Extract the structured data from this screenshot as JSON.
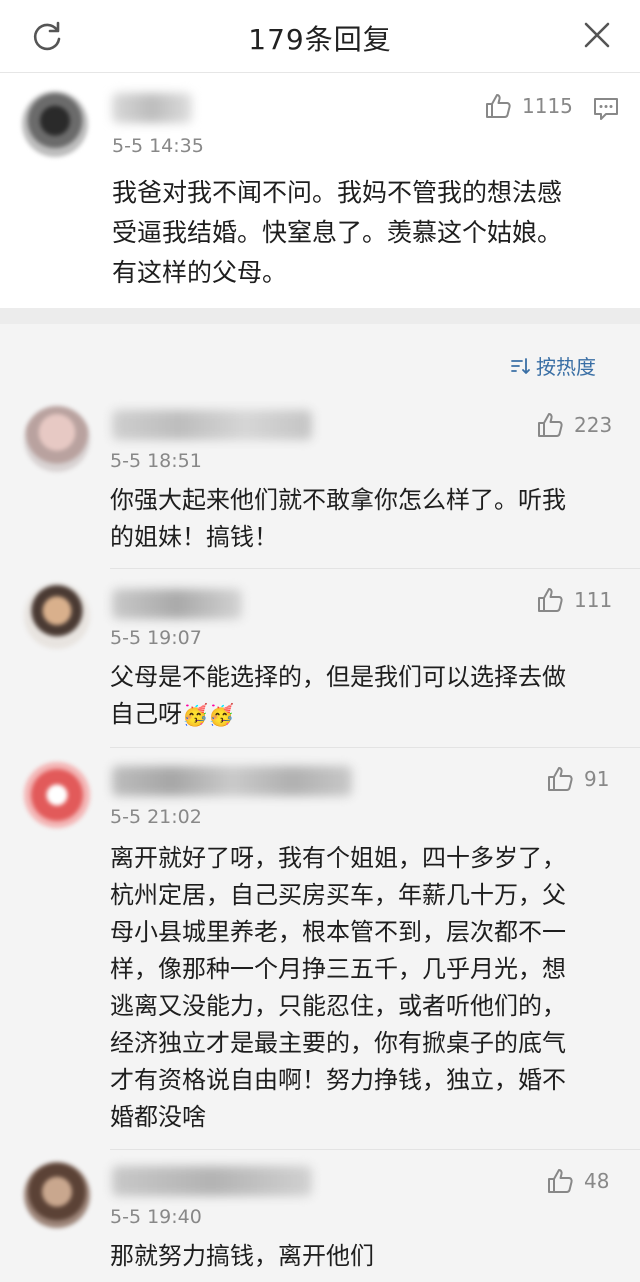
{
  "header": {
    "title": "179条回复",
    "icons": [
      "refresh-icon",
      "close-icon"
    ]
  },
  "main_post": {
    "time": "5-5 14:35",
    "likes": "1115",
    "text_lines": [
      "我爸对我不闻不问。我妈不管我的想法感",
      "受逼我结婚。快窒息了。羡慕这个姑娘。",
      "有这样的父母。"
    ]
  },
  "sort": {
    "label": "按热度"
  },
  "comments": [
    {
      "time": "5-5 18:51",
      "likes": "223",
      "text_lines": [
        "你强大起来他们就不敢拿你怎么样了。听我",
        "的姐妹！搞钱！"
      ]
    },
    {
      "time": "5-5 19:07",
      "likes": "111",
      "text_lines": [
        "父母是不能选择的，但是我们可以选择去做",
        "自己呀"
      ],
      "emoji": "🥳🥳"
    },
    {
      "time": "5-5 21:02",
      "likes": "91",
      "text_lines": [
        "离开就好了呀，我有个姐姐，四十多岁了，",
        "杭州定居，自己买房买车，年薪几十万，父",
        "母小县城里养老，根本管不到，层次都不一",
        "样，像那种一个月挣三五千，几乎月光，想",
        "逃离又没能力，只能忍住，或者听他们的，",
        "经济独立才是最主要的，你有掀桌子的底气",
        "才有资格说自由啊！努力挣钱，独立，婚不",
        "婚都没啥"
      ]
    },
    {
      "time": "5-5 19:40",
      "likes": "48",
      "text_lines": [
        "那就努力搞钱，离开他们"
      ]
    }
  ],
  "colors": {
    "link_blue": "#3a6fa5",
    "meta_gray": "#888888"
  }
}
